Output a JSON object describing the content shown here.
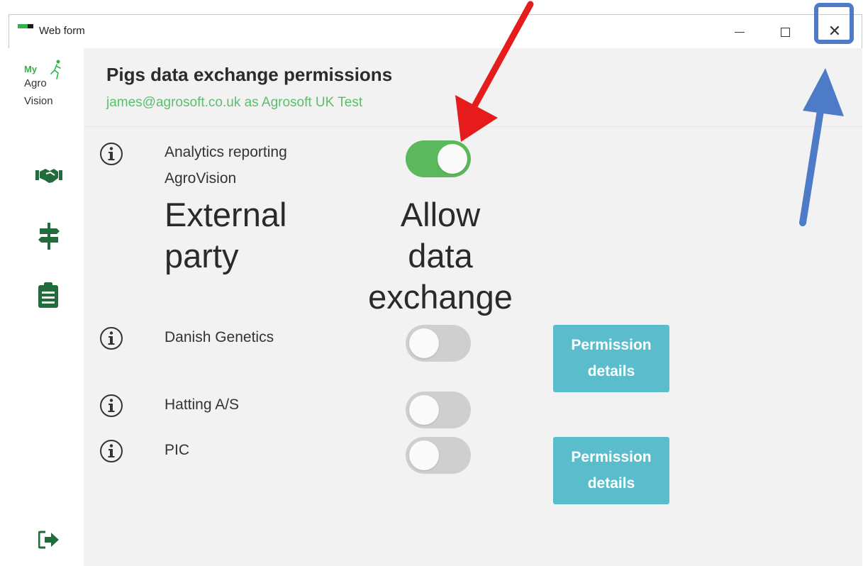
{
  "window": {
    "title": "Web form"
  },
  "sidebar": {
    "logo": {
      "my": "My",
      "agro": "Agro",
      "vision": "Vision"
    },
    "icons": [
      "handshake-icon",
      "signpost-icon",
      "clipboard-icon",
      "logout-icon"
    ]
  },
  "page": {
    "title": "Pigs data exchange permissions",
    "subtitle": "james@agrosoft.co.uk as Agrosoft UK Test"
  },
  "analytics": {
    "label_line1": "Analytics reporting",
    "label_line2": "AgroVision",
    "enabled": true
  },
  "column_headers": {
    "party_line1": "External",
    "party_line2": "party",
    "allow_line1": "Allow",
    "allow_line2": "data",
    "allow_line3": "exchange"
  },
  "parties": [
    {
      "name": "Danish Genetics",
      "enabled": false,
      "button": "Permission details"
    },
    {
      "name": "Hatting A/S",
      "enabled": false
    },
    {
      "name": "PIC",
      "enabled": false,
      "button": "Permission details"
    }
  ],
  "colors": {
    "accent_green": "#5cb85c",
    "subtitle_green": "#5cbd6e",
    "button_teal": "#5bbdcb",
    "annotation_red": "#e61b1b",
    "annotation_blue": "#4e7bc7"
  }
}
